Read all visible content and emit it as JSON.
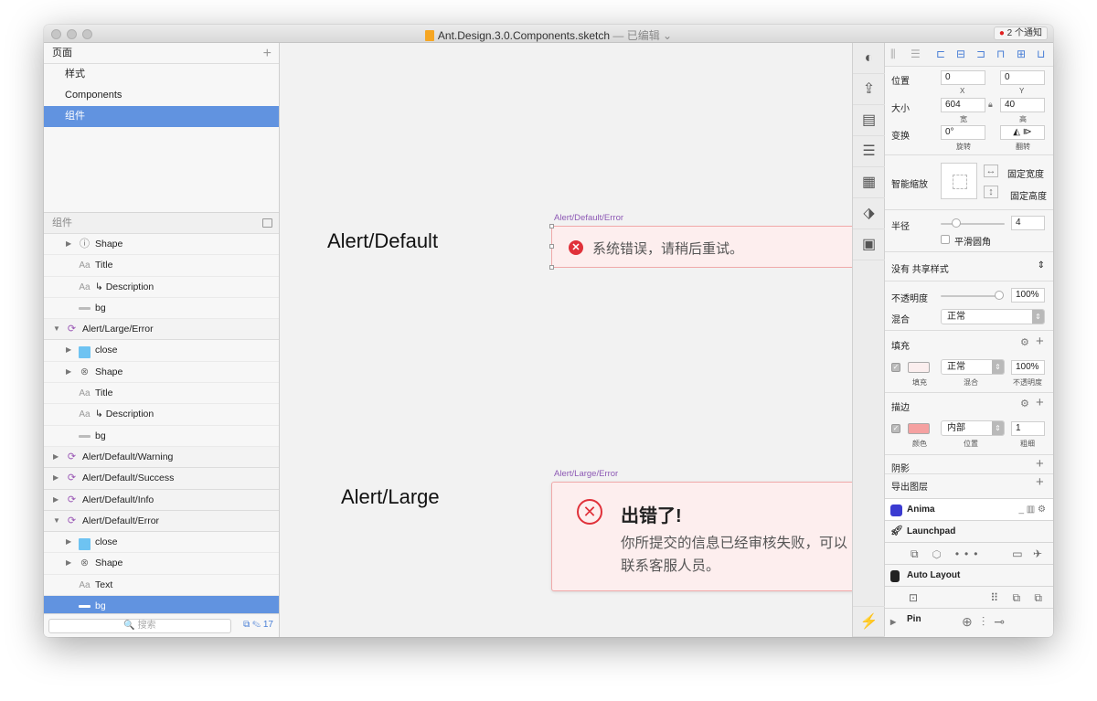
{
  "window": {
    "title": "Ant.Design.3.0.Components.sketch",
    "title_suffix": "— 已编辑 ⌄",
    "notifications": "2 个通知"
  },
  "pages": {
    "header": "页面",
    "add_icon": "+",
    "items": [
      {
        "label": "样式",
        "selected": false
      },
      {
        "label": "Components",
        "selected": false
      },
      {
        "label": "组件",
        "selected": true
      }
    ]
  },
  "layers": {
    "header": "组件",
    "rows": [
      {
        "label": "Shape",
        "indent": 1,
        "icon": "shape-info-icon",
        "glyph": "ⓘ",
        "tri": true,
        "kind": "child"
      },
      {
        "label": "Title",
        "indent": 1,
        "icon": "text-icon",
        "glyph": "Aa",
        "tri": false,
        "kind": "child"
      },
      {
        "label": "↳ Description",
        "indent": 1,
        "icon": "text-icon",
        "glyph": "Aa",
        "tri": false,
        "kind": "child"
      },
      {
        "label": "bg",
        "indent": 1,
        "icon": "rectangle-icon",
        "glyph": "",
        "tri": false,
        "kind": "child"
      },
      {
        "label": "Alert/Large/Error",
        "indent": 0,
        "icon": "symbol-icon",
        "glyph": "⟳",
        "tri": true,
        "open": true,
        "kind": "group"
      },
      {
        "label": "close",
        "indent": 1,
        "icon": "folder-icon",
        "glyph": "",
        "tri": true,
        "kind": "child"
      },
      {
        "label": "Shape",
        "indent": 1,
        "icon": "shape-close-icon",
        "glyph": "⊗",
        "tri": true,
        "kind": "child"
      },
      {
        "label": "Title",
        "indent": 1,
        "icon": "text-icon",
        "glyph": "Aa",
        "tri": false,
        "kind": "child"
      },
      {
        "label": "↳ Description",
        "indent": 1,
        "icon": "text-icon",
        "glyph": "Aa",
        "tri": false,
        "kind": "child"
      },
      {
        "label": "bg",
        "indent": 1,
        "icon": "rectangle-icon",
        "glyph": "",
        "tri": false,
        "kind": "child"
      },
      {
        "label": "Alert/Default/Warning",
        "indent": 0,
        "icon": "symbol-icon",
        "glyph": "⟳",
        "tri": true,
        "open": false,
        "kind": "group"
      },
      {
        "label": "Alert/Default/Success",
        "indent": 0,
        "icon": "symbol-icon",
        "glyph": "⟳",
        "tri": true,
        "open": false,
        "kind": "group"
      },
      {
        "label": "Alert/Default/Info",
        "indent": 0,
        "icon": "symbol-icon",
        "glyph": "⟳",
        "tri": true,
        "open": false,
        "kind": "group"
      },
      {
        "label": "Alert/Default/Error",
        "indent": 0,
        "icon": "symbol-icon",
        "glyph": "⟳",
        "tri": true,
        "open": true,
        "kind": "group"
      },
      {
        "label": "close",
        "indent": 1,
        "icon": "folder-icon",
        "glyph": "",
        "tri": true,
        "kind": "child"
      },
      {
        "label": "Shape",
        "indent": 1,
        "icon": "shape-close-icon",
        "glyph": "⊗",
        "tri": true,
        "kind": "child"
      },
      {
        "label": "Text",
        "indent": 1,
        "icon": "text-icon",
        "glyph": "Aa",
        "tri": false,
        "kind": "child"
      },
      {
        "label": "bg",
        "indent": 1,
        "icon": "rectangle-icon",
        "glyph": "",
        "tri": false,
        "kind": "selected"
      }
    ],
    "search_placeholder": "🔍 搜索",
    "count": "17"
  },
  "canvas": {
    "heading_default": "Alert/Default",
    "heading_large": "Alert/Large",
    "label_default": "Alert/Default/Error",
    "label_large": "Alert/Large/Error",
    "default_message": "系统错误，请稍后重试。",
    "large_title": "出错了!",
    "large_description": "你所提交的信息已经审核失败，可以联系客服人员。",
    "error_color": "#e0313a",
    "alert_bg": "#fdeeee"
  },
  "inspector": {
    "position": {
      "label": "位置",
      "x": "0",
      "y": "0",
      "x_label": "X",
      "y_label": "Y"
    },
    "size": {
      "label": "大小",
      "w": "604",
      "h": "40",
      "w_label": "宽",
      "h_label": "高"
    },
    "transform": {
      "label": "变换",
      "rotate": "0°",
      "rotate_label": "旋转",
      "flip_label": "翻转"
    },
    "resizing": {
      "label": "智能缩放",
      "fix_width": "固定宽度",
      "fix_height": "固定高度"
    },
    "radius": {
      "label": "半径",
      "value": "4",
      "smooth": "平滑圆角"
    },
    "shared_style": "没有 共享样式",
    "opacity": {
      "label": "不透明度",
      "value": "100%"
    },
    "blend": {
      "label": "混合",
      "value": "正常"
    },
    "fill": {
      "label": "填充",
      "swatch_label": "填充",
      "blend": "正常",
      "blend_label": "混合",
      "opacity": "100%",
      "opacity_label": "不透明度",
      "color": "#fbeeee"
    },
    "border": {
      "label": "描边",
      "swatch_label": "颜色",
      "position": "内部",
      "position_label": "位置",
      "width": "1",
      "width_label": "粗细",
      "color": "#f5a1a1"
    },
    "shadow": "阴影",
    "export": "导出图层",
    "plugins": {
      "anima": "Anima",
      "launchpad": "Launchpad",
      "auto_layout": "Auto Layout",
      "pin": "Pin"
    }
  }
}
